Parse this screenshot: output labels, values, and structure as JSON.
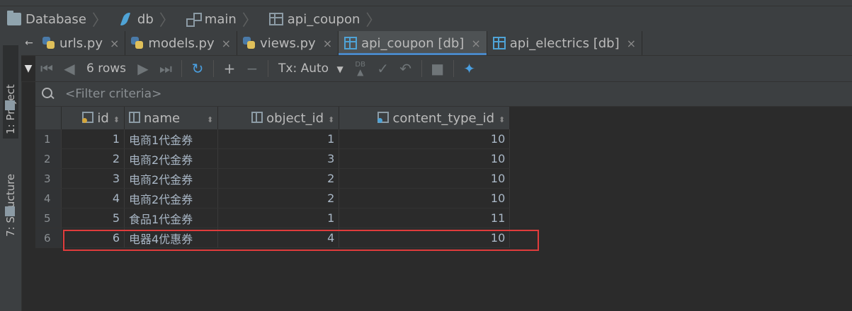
{
  "breadcrumb": [
    "Database",
    "db",
    "main",
    "api_coupon"
  ],
  "side_tabs": {
    "project": "1: Project",
    "structure": "7: Structure"
  },
  "tabs": [
    {
      "label": "urls.py",
      "icon": "python-file-icon"
    },
    {
      "label": "models.py",
      "icon": "python-file-icon"
    },
    {
      "label": "views.py",
      "icon": "python-file-icon"
    },
    {
      "label": "api_coupon [db]",
      "icon": "table-icon",
      "active": true
    },
    {
      "label": "api_electrics [db]",
      "icon": "table-icon"
    }
  ],
  "toolbar": {
    "rows_label": "6 rows",
    "tx_label": "Tx: Auto",
    "db_label": "DB"
  },
  "filter": {
    "placeholder": "<Filter criteria>"
  },
  "table": {
    "columns": [
      "id",
      "name",
      "object_id",
      "content_type_id"
    ],
    "rows": [
      {
        "n": "1",
        "id": "1",
        "name": "电商1代金券",
        "object_id": "1",
        "content_type_id": "10"
      },
      {
        "n": "2",
        "id": "2",
        "name": "电商2代金券",
        "object_id": "3",
        "content_type_id": "10"
      },
      {
        "n": "3",
        "id": "3",
        "name": "电商2代金券",
        "object_id": "2",
        "content_type_id": "10"
      },
      {
        "n": "4",
        "id": "4",
        "name": "电商2代金券",
        "object_id": "2",
        "content_type_id": "10"
      },
      {
        "n": "5",
        "id": "5",
        "name": "食品1代金券",
        "object_id": "1",
        "content_type_id": "11"
      },
      {
        "n": "6",
        "id": "6",
        "name": "电器4优惠券",
        "object_id": "4",
        "content_type_id": "10"
      }
    ]
  },
  "colors": {
    "highlight": "#e03c3c",
    "accent": "#4a88c7",
    "background": "#2b2b2b"
  }
}
